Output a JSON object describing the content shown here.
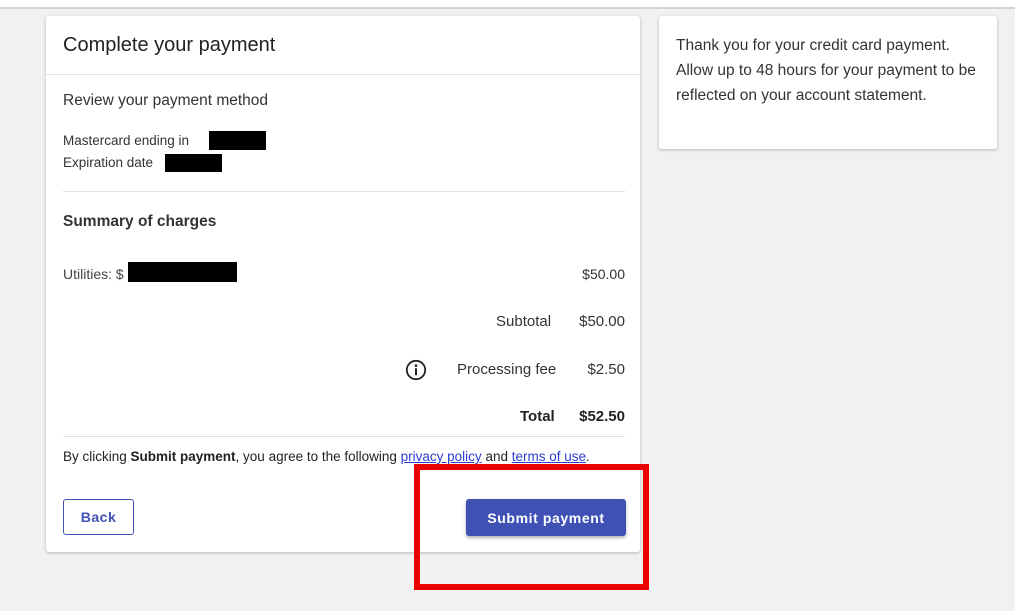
{
  "page": {
    "title": "Complete your payment"
  },
  "payment_method": {
    "section_label": "Review your payment method",
    "card_line_label": "Mastercard ending in",
    "expiration_label": "Expiration date"
  },
  "summary": {
    "title": "Summary of charges",
    "line_items": [
      {
        "label": "Utilities: $",
        "amount": "$50.00"
      }
    ],
    "subtotal_label": "Subtotal",
    "subtotal_amount": "$50.00",
    "processing_fee_label": "Processing fee",
    "processing_fee_amount": "$2.50",
    "total_label": "Total",
    "total_amount": "$52.50"
  },
  "agreement": {
    "prefix": "By clicking ",
    "bold": "Submit payment",
    "middle": ", you agree to the following ",
    "privacy_link": "privacy policy",
    "and": " and ",
    "terms_link": "terms of use",
    "suffix": "."
  },
  "actions": {
    "back_label": "Back",
    "submit_label": "Submit payment"
  },
  "side_message": {
    "text": "Thank you for your credit card payment. Allow up to 48 hours for your payment to be reflected on your account statement."
  },
  "colors": {
    "primary": "#3f51b5",
    "link": "#2a3ed6",
    "highlight_box": "#ea0000",
    "background": "#f1f1f1"
  },
  "icons": {
    "processing_fee_info": "info-icon"
  }
}
